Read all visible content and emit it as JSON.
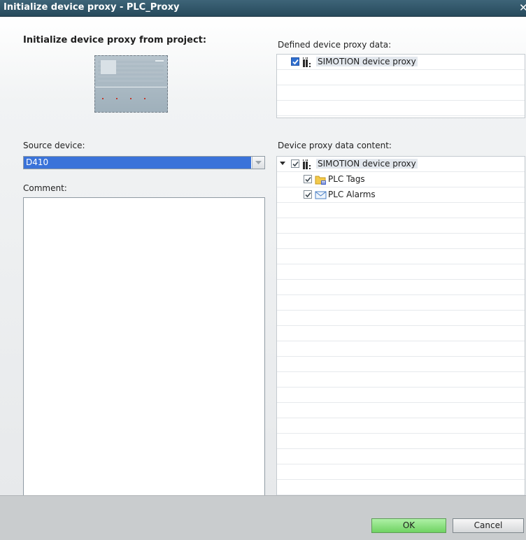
{
  "window": {
    "title": "Initialize device proxy - PLC_Proxy"
  },
  "left": {
    "heading": "Initialize device proxy from project:",
    "source_label": "Source device:",
    "source_value": "D410",
    "comment_label": "Comment:",
    "comment_value": ""
  },
  "right": {
    "defined_label": "Defined device proxy data:",
    "defined_items": [
      {
        "label": "SIMOTION device proxy",
        "checked": true,
        "icon": "device-proxy-icon"
      }
    ],
    "content_label": "Device proxy data content:",
    "content_tree": {
      "root": {
        "label": "SIMOTION device proxy",
        "checked": true,
        "expanded": true,
        "icon": "device-proxy-icon"
      },
      "children": [
        {
          "label": "PLC Tags",
          "checked": true,
          "icon": "folder-tags-icon"
        },
        {
          "label": "PLC Alarms",
          "checked": true,
          "icon": "envelope-icon"
        }
      ]
    }
  },
  "buttons": {
    "ok": "OK",
    "cancel": "Cancel"
  },
  "colors": {
    "title_bar": "#2f5669",
    "selection": "#3a73d9",
    "ok_button": "#8fe085",
    "footer": "#c9ccce"
  }
}
